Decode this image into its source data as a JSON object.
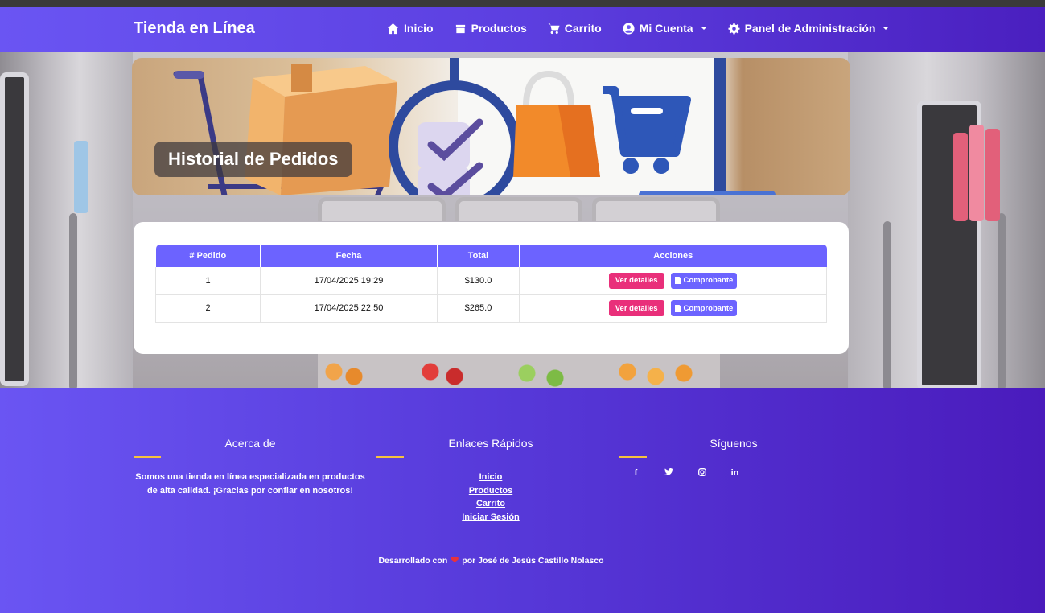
{
  "navbar": {
    "brand": "Tienda en Línea",
    "items": [
      {
        "label": "Inicio",
        "icon": "home-icon"
      },
      {
        "label": "Productos",
        "icon": "box-icon"
      },
      {
        "label": "Carrito",
        "icon": "cart-icon"
      },
      {
        "label": "Mi Cuenta",
        "icon": "user-circle-icon",
        "dropdown": true
      },
      {
        "label": "Panel de Administración",
        "icon": "gear-icon",
        "dropdown": true
      }
    ]
  },
  "hero": {
    "title": "Historial de Pedidos"
  },
  "orders": {
    "headers": [
      "# Pedido",
      "Fecha",
      "Total",
      "Acciones"
    ],
    "rows": [
      {
        "id": "1",
        "date": "17/04/2025 19:29",
        "total": "$130.0"
      },
      {
        "id": "2",
        "date": "17/04/2025 22:50",
        "total": "$265.0"
      }
    ],
    "details_label": "Ver detalles",
    "receipt_label": "Comprobante"
  },
  "footer": {
    "about_title": "Acerca de",
    "about_text": "Somos una tienda en línea especializada en productos de alta calidad. ¡Gracias por confiar en nosotros!",
    "links_title": "Enlaces Rápidos",
    "links": [
      "Inicio",
      "Productos",
      "Carrito",
      "Iniciar Sesión"
    ],
    "social_title": "Síguenos",
    "social": [
      "f",
      "t",
      "ig",
      "in"
    ],
    "credits_prefix": "Desarrollado con",
    "credits_suffix": "por José de Jesús Castillo Nolasco"
  },
  "colors": {
    "primary": "#6c63ff",
    "accent_pink": "#e92f7a",
    "footer_bar": "#f6c23e"
  }
}
